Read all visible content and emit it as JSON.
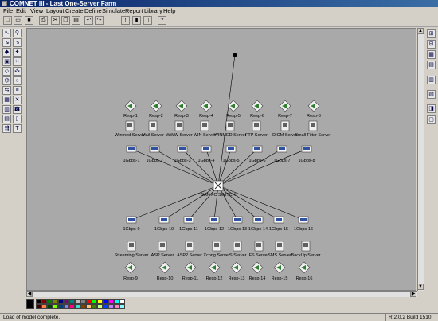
{
  "window": {
    "title": "COMNET III - Last One-Server Farm"
  },
  "menu": [
    "File",
    "Edit",
    "View",
    "Layout",
    "Create",
    "Define",
    "Simulate",
    "Report",
    "Library",
    "Help"
  ],
  "toolbar_icons": [
    "new-icon",
    "open-icon",
    "save-icon",
    "print-icon",
    "cut-icon",
    "copy-icon",
    "paste-icon",
    "undo-icon",
    "redo-icon",
    "verify-icon",
    "go-icon",
    "animate-icon",
    "help-icon"
  ],
  "left_tools": [
    "select-icon",
    "zoom-icon",
    "link-icon",
    "arc-icon",
    "router-icon",
    "switch-icon",
    "node-icon",
    "group-icon",
    "wan-icon",
    "transit-icon",
    "lan-icon",
    "token-ring-icon",
    "bus-icon",
    "processor-icon",
    "computer-icon",
    "cloud-icon",
    "message-source-icon",
    "call-source-icon",
    "response-source-icon",
    "session-source-icon",
    "text-icon",
    "globe-icon"
  ],
  "right_tools": [
    "zoom-in-icon",
    "zoom-out-icon",
    "grid-icon",
    "layout-icon",
    "snap-icon",
    "calc-icon",
    "clip-icon",
    "note-icon"
  ],
  "network": {
    "responses_top": [
      "Resp-1",
      "Resp-2",
      "Resp-3",
      "Resp-4",
      "Resp-5",
      "Resp-6",
      "Resp-7",
      "Resp-8"
    ],
    "servers_top": [
      "Winmed Server",
      "Mail Server",
      "WWW Server",
      "WIN Server",
      "WINMED Server",
      "FTP Server",
      "DICM Server",
      "Small Filter Server"
    ],
    "links_top": [
      "1Gbps-1",
      "1Gbps-2",
      "1Gbps-3",
      "1Gbps-4",
      "1Gbps-5",
      "1Gbps-6",
      "1Gbps-7",
      "1Gbps-8"
    ],
    "switch": "SAN FC SWITCH",
    "links_bottom": [
      "1Gbps-9",
      "1Gbps-10",
      "1Gbps-11",
      "1Gbps-12",
      "1Gbps-13",
      "1Gbps-14",
      "1Gbps-15",
      "1Gbps-16"
    ],
    "servers_bottom": [
      "Streaming Server",
      "ASP Server",
      "ASP2 Server",
      "Xcong Server",
      "IS Server",
      "FS Server",
      "SMS Server",
      "BackUp Server"
    ],
    "responses_bottom": [
      "Resp-9",
      "Resp-10",
      "Resp-11",
      "Resp-12",
      "Resp-13",
      "Resp-14",
      "Resp-15",
      "Resp-16"
    ]
  },
  "palette_colors": [
    "#000000",
    "#800000",
    "#008000",
    "#808000",
    "#000080",
    "#800080",
    "#008080",
    "#c0c0c0",
    "#808080",
    "#ff0000",
    "#00ff00",
    "#ffff00",
    "#0000ff",
    "#ff00ff",
    "#00ffff",
    "#ffffff",
    "#400000",
    "#ff8040",
    "#004000",
    "#80ff00",
    "#004080",
    "#8080ff",
    "#ff0080",
    "#40e0d0",
    "#804000",
    "#ffc080",
    "#408000",
    "#c0ff80",
    "#0040ff",
    "#c080ff",
    "#ff80c0",
    "#80ffff"
  ],
  "status": {
    "message": "Load of model complete.",
    "version": "R 2.0.2 Build 1510"
  }
}
